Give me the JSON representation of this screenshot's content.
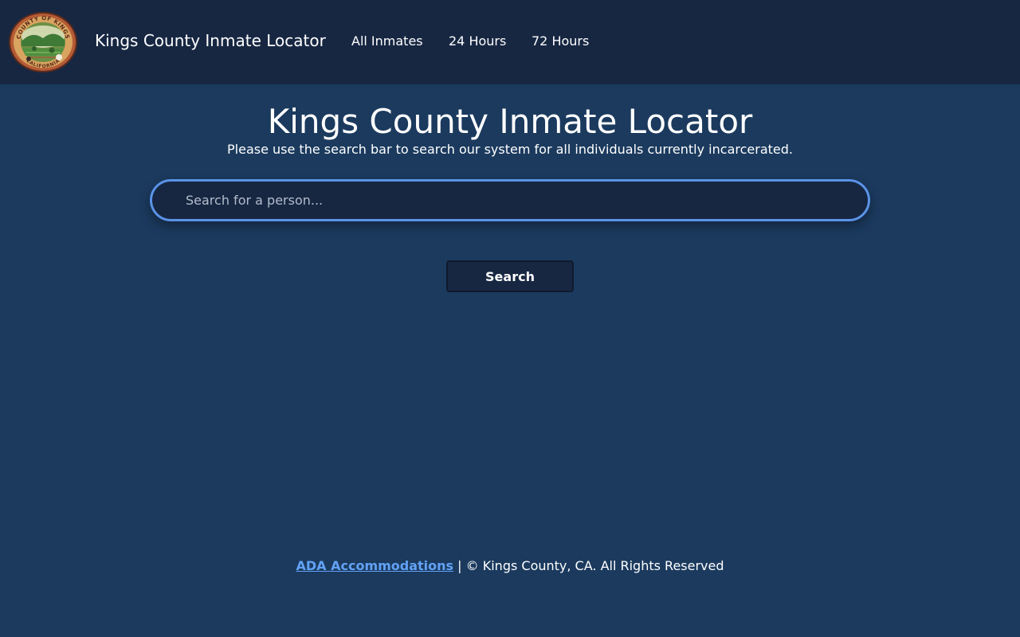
{
  "navbar": {
    "brand": "Kings County Inmate Locator",
    "logo": {
      "icon": "county-seal-icon",
      "text_top": "COUNTY OF KINGS",
      "text_bottom": "CALIFORNIA"
    },
    "links": [
      {
        "label": "All Inmates"
      },
      {
        "label": "24 Hours"
      },
      {
        "label": "72 Hours"
      }
    ]
  },
  "main": {
    "title": "Kings County Inmate Locator",
    "subtitle": "Please use the search bar to search our system for all individuals currently incarcerated.",
    "search": {
      "placeholder": "Search for a person...",
      "value": ""
    },
    "search_button_label": "Search"
  },
  "footer": {
    "ada_link": "ADA Accommodations",
    "separator": "|",
    "copyright": "© Kings County, CA. All Rights Reserved"
  },
  "colors": {
    "page_background": "#1b3a5e",
    "navbar_background": "#172742",
    "input_border": "#5a93e8",
    "link": "#62a2f5",
    "text": "#ffffff"
  }
}
